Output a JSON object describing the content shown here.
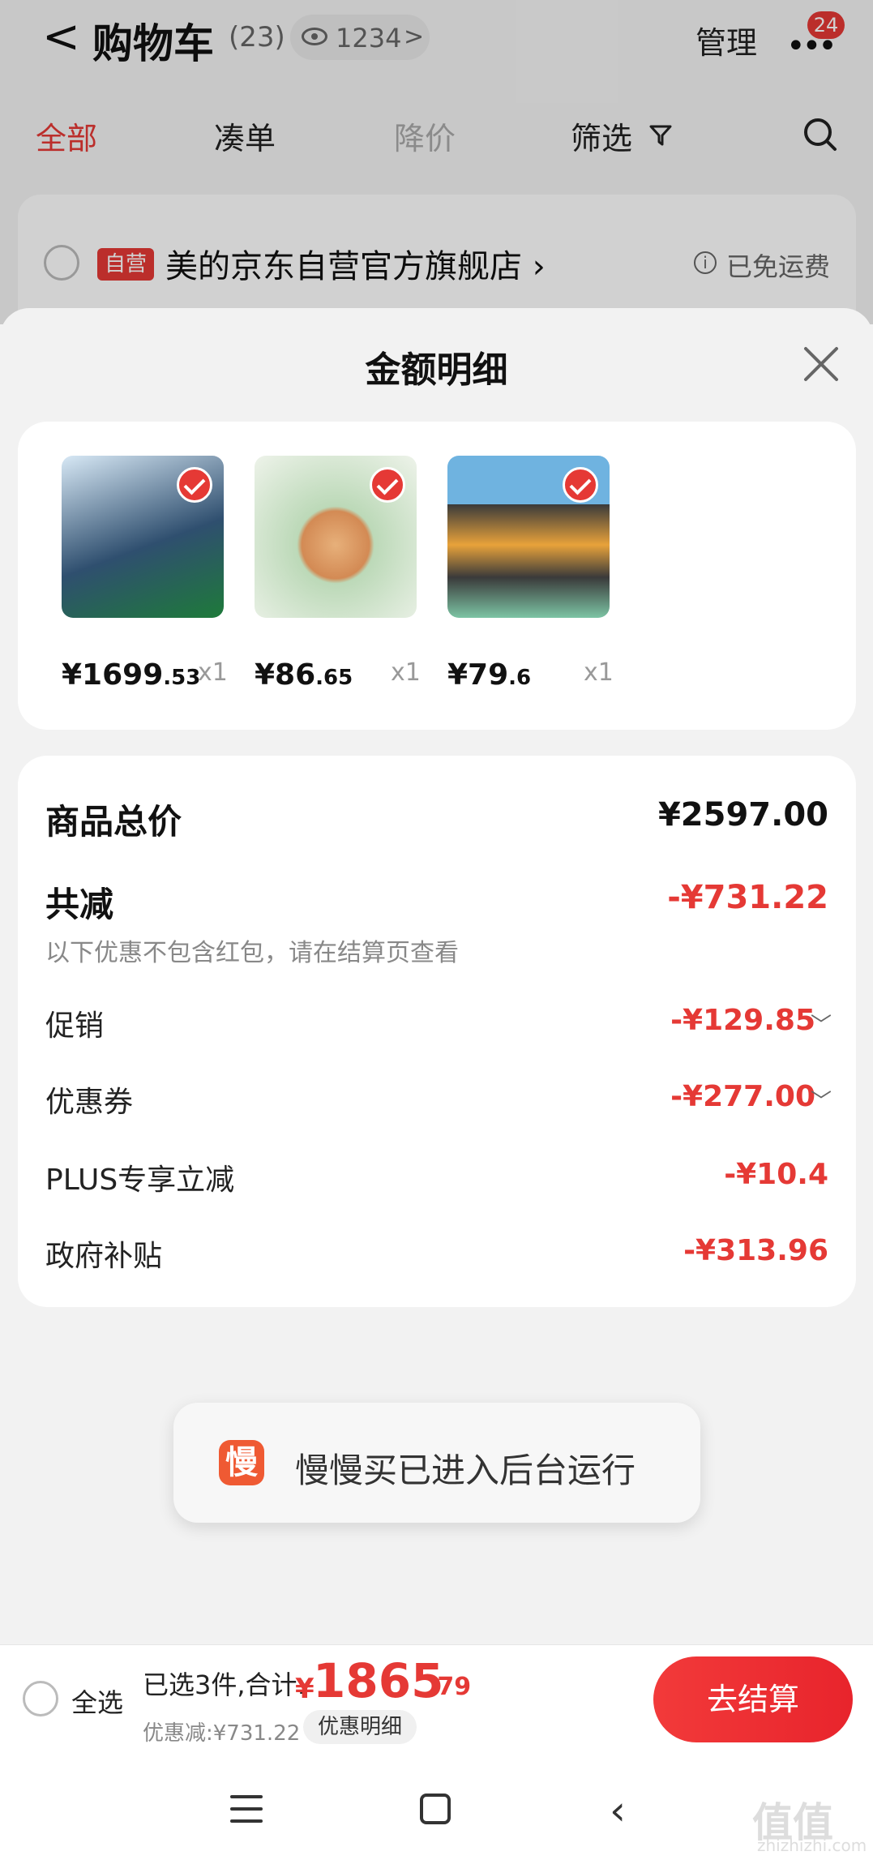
{
  "header": {
    "back_glyph": "<",
    "title": "购物车",
    "count": "(23)",
    "viewed_count": "1234",
    "viewed_chevron": ">",
    "manage_label": "管理",
    "more_badge": "24"
  },
  "tabs": [
    {
      "label": "全部",
      "state": "active"
    },
    {
      "label": "凑单",
      "state": "normal"
    },
    {
      "label": "降价",
      "state": "disabled"
    },
    {
      "label": "筛选",
      "state": "normal"
    }
  ],
  "store": {
    "tag": "自营",
    "name": "美的京东自营官方旗舰店 ›",
    "shipping": "已免运费"
  },
  "sheet": {
    "title": "金额明细"
  },
  "products": [
    {
      "price_int": "¥1699",
      "price_dec": ".53",
      "qty": "x1",
      "color": "#2f4f6f",
      "checked": true
    },
    {
      "price_int": "¥86",
      "price_dec": ".65",
      "qty": "x1",
      "color": "#bcd9b8",
      "checked": true
    },
    {
      "price_int": "¥79",
      "price_dec": ".6",
      "qty": "x1",
      "color": "#6fb3e0",
      "checked": true
    }
  ],
  "amounts": {
    "total_label": "商品总价",
    "total_value": "¥2597.00",
    "reduce_label": "共减",
    "reduce_value": "-¥731.22",
    "note": "以下优惠不包含红包，请在结算页查看",
    "items": [
      {
        "label": "促销",
        "value": "-¥129.85",
        "expandable": true
      },
      {
        "label": "优惠券",
        "value": "-¥277.00",
        "expandable": true
      },
      {
        "label": "PLUS专享立减",
        "value": "-¥10.4",
        "expandable": false
      },
      {
        "label": "政府补贴",
        "value": "-¥313.96",
        "expandable": false
      }
    ]
  },
  "toast": {
    "icon_char": "慢",
    "text": "慢慢买已进入后台运行"
  },
  "bottom": {
    "select_all": "全选",
    "selected_text": "已选3件,合计:",
    "total_yen": "¥",
    "total_int": "1865",
    "total_dec": ".79",
    "saved_text": "优惠减:¥731.22",
    "detail_label": "优惠明细",
    "checkout_label": "去结算"
  },
  "watermark": {
    "main": "值值值",
    "sub": "zhizhizhi.com"
  },
  "colors": {
    "accent": "#e53935",
    "background": "#f2f2f2"
  }
}
